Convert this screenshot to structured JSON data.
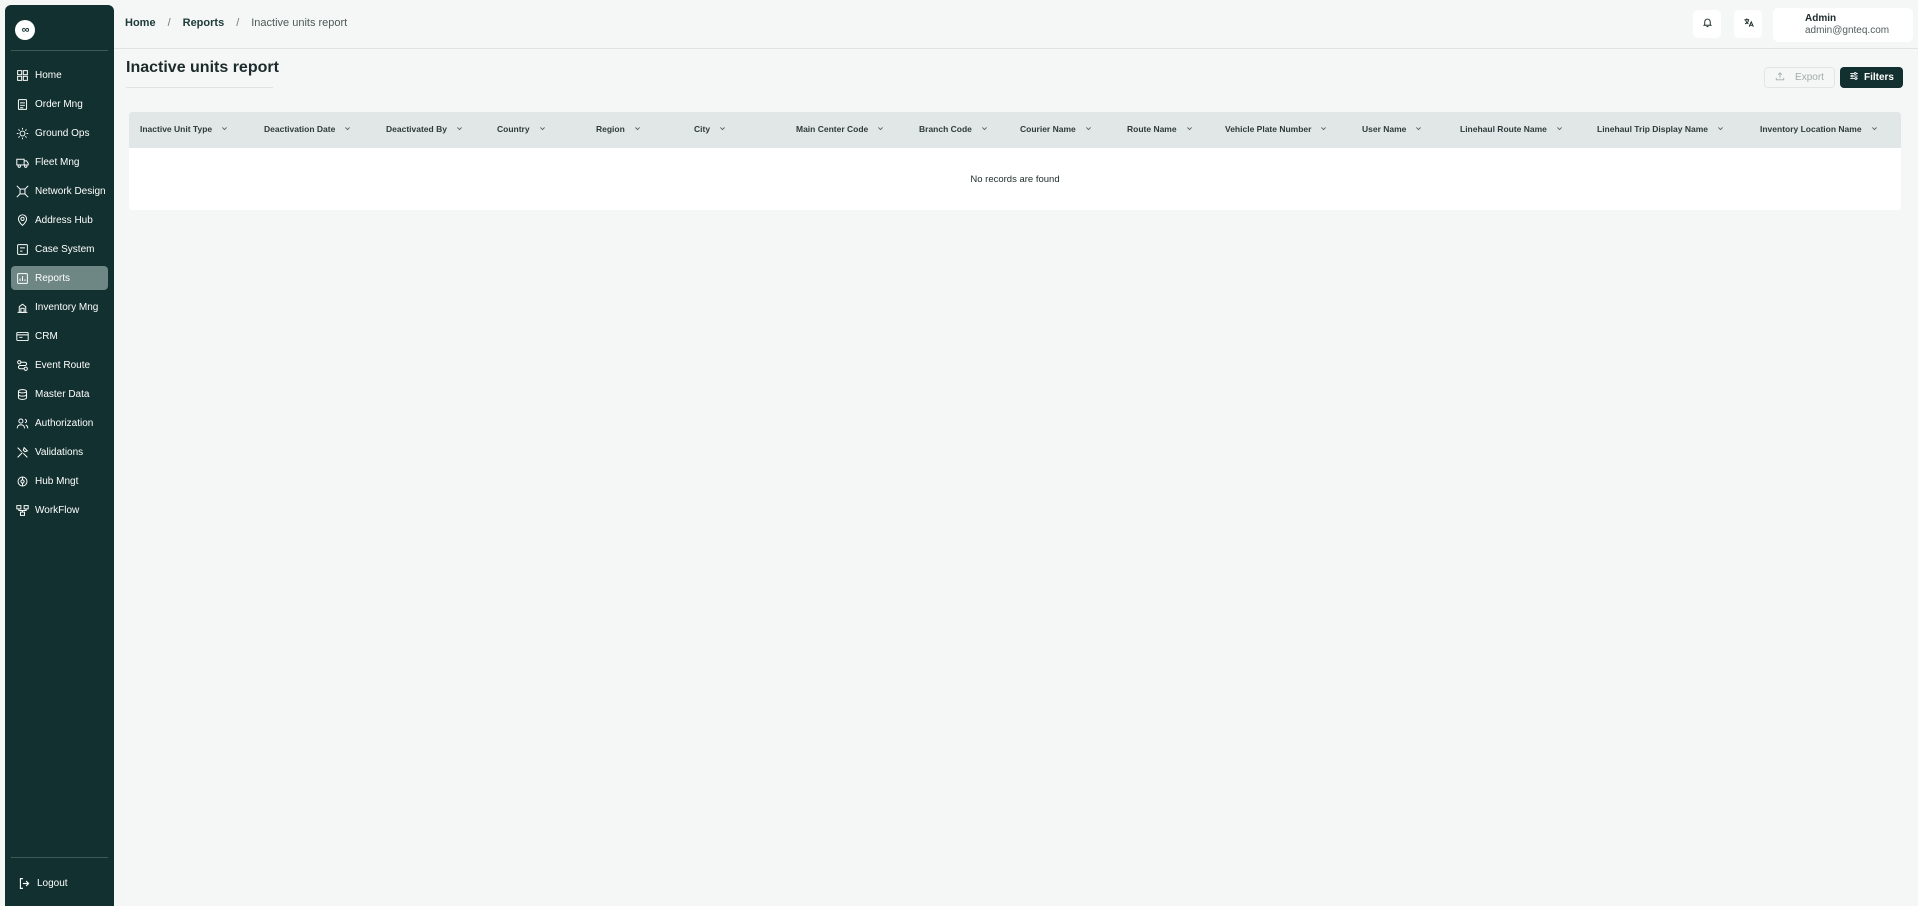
{
  "sidebar": {
    "logo": "∞",
    "items": [
      {
        "label": "Home",
        "icon": "home-grid-icon",
        "active": false
      },
      {
        "label": "Order Mng",
        "icon": "order-icon",
        "active": false
      },
      {
        "label": "Ground Ops",
        "icon": "ground-ops-icon",
        "active": false
      },
      {
        "label": "Fleet Mng",
        "icon": "truck-icon",
        "active": false
      },
      {
        "label": "Network Design",
        "icon": "network-icon",
        "active": false
      },
      {
        "label": "Address Hub",
        "icon": "address-pin-icon",
        "active": false
      },
      {
        "label": "Case System",
        "icon": "case-icon",
        "active": false
      },
      {
        "label": "Reports",
        "icon": "report-icon",
        "active": true
      },
      {
        "label": "Inventory Mng",
        "icon": "inventory-icon",
        "active": false
      },
      {
        "label": "CRM",
        "icon": "crm-icon",
        "active": false
      },
      {
        "label": "Event Route",
        "icon": "route-icon",
        "active": false
      },
      {
        "label": "Master Data",
        "icon": "database-icon",
        "active": false
      },
      {
        "label": "Authorization",
        "icon": "users-icon",
        "active": false
      },
      {
        "label": "Validations",
        "icon": "tools-icon",
        "active": false
      },
      {
        "label": "Hub Mngt",
        "icon": "hub-icon",
        "active": false
      },
      {
        "label": "WorkFlow",
        "icon": "workflow-icon",
        "active": false
      }
    ],
    "logout_label": "Logout"
  },
  "header": {
    "breadcrumb": {
      "home": "Home",
      "reports": "Reports",
      "current": "Inactive units report",
      "separator": "/"
    },
    "user": {
      "name": "Admin",
      "email": "admin@gnteq.com"
    }
  },
  "page": {
    "title": "Inactive units report",
    "export_label": "Export",
    "filters_label": "Filters"
  },
  "table": {
    "columns": [
      "Inactive Unit Type",
      "Deactivation Date",
      "Deactivated By",
      "Country",
      "Region",
      "City",
      "Main Center Code",
      "Branch Code",
      "Courier Name",
      "Route Name",
      "Vehicle Plate Number",
      "User Name",
      "Linehaul Route Name",
      "Linehaul Trip Display Name",
      "Inventory Location Name"
    ],
    "empty_message": "No records are found"
  },
  "colors": {
    "sidebar_bg": "#12302f",
    "active_item_bg": "#6e8785",
    "page_bg": "#f5f7f6",
    "table_head_bg": "#e1e7e6",
    "primary_button": "#12302f"
  }
}
